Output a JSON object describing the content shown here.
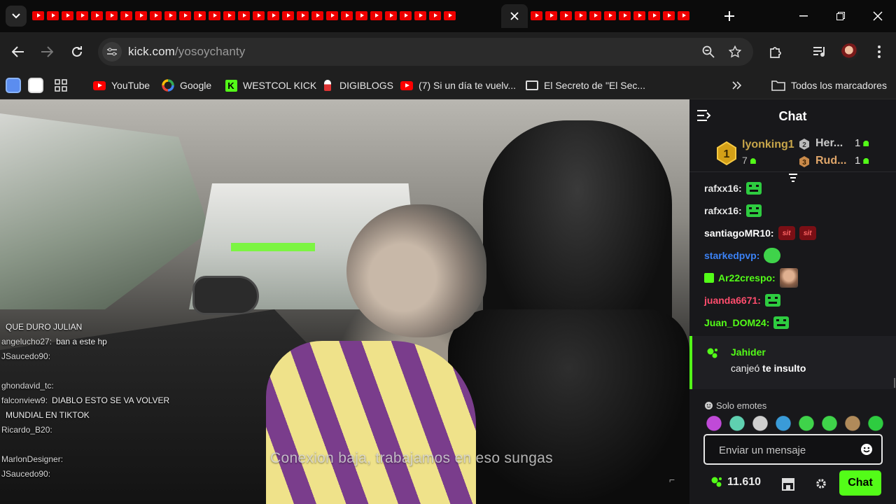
{
  "browser": {
    "tab_count_left": 29,
    "tab_count_right": 11,
    "url_domain": "kick.com",
    "url_path": "/yosoychanty"
  },
  "bookmarks": [
    {
      "label": "YouTube",
      "icon": "youtube-icon"
    },
    {
      "label": "Google",
      "icon": "google-icon"
    },
    {
      "label": "WESTCOL KICK",
      "icon": "kick-icon"
    },
    {
      "label": "DIGIBLOGS",
      "icon": "digiblogs-icon"
    },
    {
      "label": "(7) Si un día te vuelv...",
      "icon": "youtube-icon"
    },
    {
      "label": "El Secreto de \"El Sec...",
      "icon": "page-icon"
    }
  ],
  "bookmarks_all": "Todos los marcadores",
  "video": {
    "subtitle": "Conexion baja, trabajamos en eso sungas",
    "overlay_chat": [
      {
        "user": "",
        "text": "QUE DURO JULIAN"
      },
      {
        "user": "angelucho27:",
        "text": "ban a este hp"
      },
      {
        "user": "JSaucedo90:",
        "text": ""
      },
      {
        "user": "",
        "text": ""
      },
      {
        "user": "ghondavid_tc:",
        "text": ""
      },
      {
        "user": "falconview9:",
        "text": "DIABLO ESTO SE VA VOLVER"
      },
      {
        "user": "",
        "text": "MUNDIAL EN TIKTOK"
      },
      {
        "user": "Ricardo_B20:",
        "text": ""
      },
      {
        "user": "",
        "text": ""
      },
      {
        "user": "MarlonDesigner:",
        "text": ""
      },
      {
        "user": "JSaucedo90:",
        "text": ""
      }
    ]
  },
  "chat": {
    "title": "Chat",
    "leaderboard": {
      "first": {
        "rank": "1",
        "name": "lyonking1",
        "count": "7"
      },
      "second": {
        "rank": "2",
        "name": "Her...",
        "count": "1"
      },
      "third": {
        "rank": "3",
        "name": "Rud...",
        "count": "1"
      }
    },
    "messages": [
      {
        "user": "rafxx16:",
        "color": "#e6e6e6",
        "emotes": [
          "green-face-emote"
        ]
      },
      {
        "user": "rafxx16:",
        "color": "#e6e6e6",
        "emotes": [
          "green-face-emote"
        ]
      },
      {
        "user": "santiagoMR10:",
        "color": "#ffffff",
        "emotes": [
          "sit-emote",
          "sit-emote"
        ]
      },
      {
        "user": "starkedpvp:",
        "color": "#3b82f6",
        "emotes": [
          "smile-emote"
        ]
      },
      {
        "user": "Ar22crespo:",
        "color": "#53fc18",
        "emotes": [
          "face-emote"
        ]
      },
      {
        "user": "juanda6671:",
        "color": "#ff4d6d",
        "emotes": [
          "green-face-emote"
        ]
      },
      {
        "user": "Juan_DOM24:",
        "color": "#53fc18",
        "emotes": [
          "green-face-emote"
        ]
      }
    ],
    "sit_label": "sit",
    "highlight": {
      "user": "Jahider",
      "text_pre": "canjeó ",
      "text_bold": "te insulto"
    },
    "emotes_label": "Solo emotes",
    "input_placeholder": "Enviar un mensaje",
    "points": "11.610",
    "send_label": "Chat",
    "accent": "#53fc18"
  }
}
